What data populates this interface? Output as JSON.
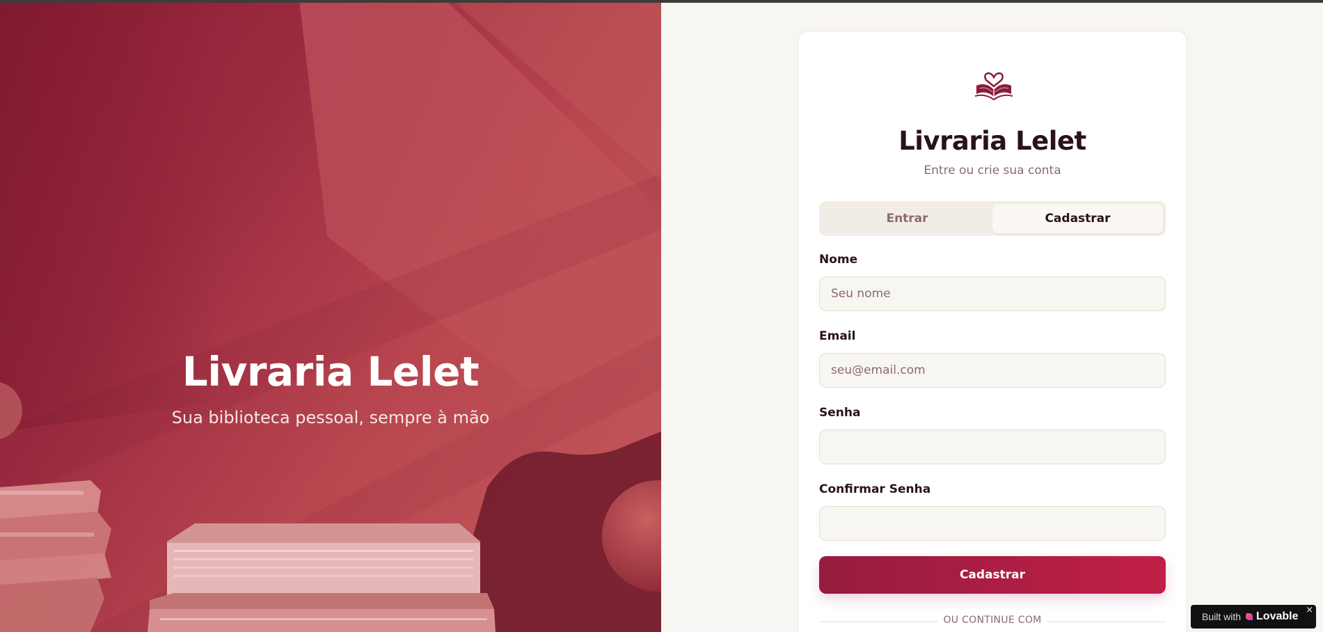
{
  "hero": {
    "title": "Livraria Lelet",
    "subtitle": "Sua biblioteca pessoal, sempre à mão"
  },
  "card": {
    "title": "Livraria Lelet",
    "subtitle": "Entre ou crie sua conta",
    "tabs": [
      {
        "label": "Entrar",
        "active": false
      },
      {
        "label": "Cadastrar",
        "active": true
      }
    ],
    "fields": {
      "name": {
        "label": "Nome",
        "placeholder": "Seu nome",
        "value": ""
      },
      "email": {
        "label": "Email",
        "placeholder": "seu@email.com",
        "value": ""
      },
      "password": {
        "label": "Senha",
        "placeholder": "",
        "value": ""
      },
      "confirm": {
        "label": "Confirmar Senha",
        "placeholder": "",
        "value": ""
      }
    },
    "submit_label": "Cadastrar",
    "divider_text": "OU CONTINUE COM"
  },
  "badge": {
    "built_text": "Built with",
    "brand": "Lovable",
    "close": "×"
  },
  "colors": {
    "brand": "#951c3e",
    "brand_end": "#c21f48",
    "text_dark": "#2a1218",
    "text_muted": "#8a6a6e",
    "background": "#f8f6f2"
  },
  "icons": {
    "logo": "book-heart-icon",
    "badge": "lovable-heart-icon",
    "close": "close-icon"
  }
}
